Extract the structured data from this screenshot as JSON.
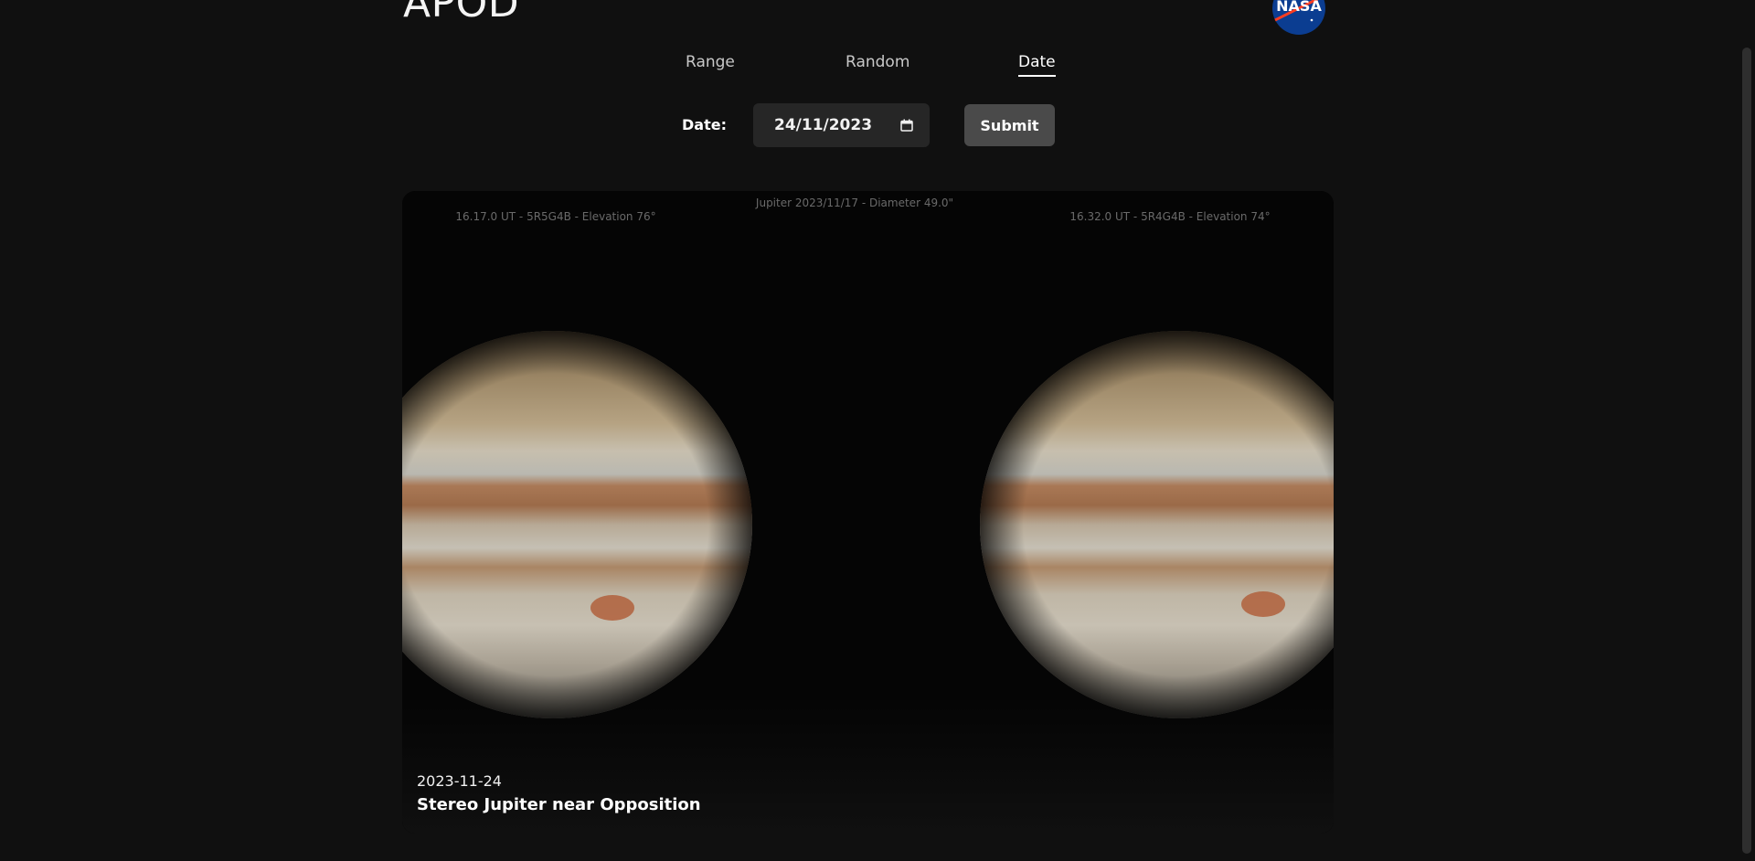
{
  "header": {
    "app_title": "APOD",
    "logo_text": "NASA"
  },
  "tabs": [
    {
      "label": "Range",
      "active": false
    },
    {
      "label": "Random",
      "active": false
    },
    {
      "label": "Date",
      "active": true
    }
  ],
  "form": {
    "date_label": "Date:",
    "date_value": "24/11/2023",
    "submit_label": "Submit"
  },
  "apod": {
    "date": "2023-11-24",
    "title": "Stereo Jupiter near Opposition",
    "image_captions": {
      "top_center": "Jupiter  2023/11/17 - Diameter 49.0\"",
      "left": "16.17.0 UT - 5R5G4B - Elevation 76°",
      "right": "16.32.0 UT - 5R4G4B - Elevation 74°"
    }
  },
  "colors": {
    "background": "#101010",
    "card": "#050505",
    "input_bg": "#262626",
    "button_bg": "#4a4a4a",
    "nasa_blue": "#0b3d91",
    "nasa_red": "#fc3d21"
  }
}
